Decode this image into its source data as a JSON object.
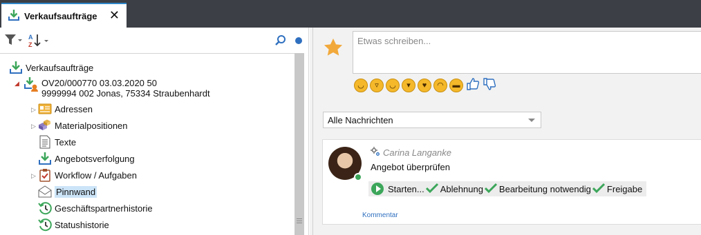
{
  "tab": {
    "title": "Verkaufsaufträge",
    "close_glyph": "✕"
  },
  "toolbar": {
    "filter_icon": "filter-icon",
    "sort_icon": "sort-az-icon",
    "search_icon": "search-icon"
  },
  "tree": {
    "root": {
      "label": "Verkaufsaufträge",
      "icon": "download-arrow-icon"
    },
    "order": {
      "line1": "OV20/000770 03.03.2020 50",
      "line2": "9999994 002 Jonas, 75334 Straubenhardt",
      "icon": "order-person-icon"
    },
    "children": [
      {
        "label": "Adressen",
        "icon": "address-card-icon",
        "expandable": true
      },
      {
        "label": "Materialpositionen",
        "icon": "boxes-icon",
        "expandable": true
      },
      {
        "label": "Texte",
        "icon": "document-icon",
        "expandable": false
      },
      {
        "label": "Angebotsverfolgung",
        "icon": "download-arrow-icon",
        "expandable": false
      },
      {
        "label": "Workflow / Aufgaben",
        "icon": "clipboard-check-icon",
        "expandable": true
      },
      {
        "label": "Pinnwand",
        "icon": "envelope-icon",
        "expandable": false,
        "selected": true
      },
      {
        "label": "Geschäftspartnerhistorie",
        "icon": "history-icon",
        "expandable": false
      },
      {
        "label": "Statushistorie",
        "icon": "history-icon",
        "expandable": false
      }
    ]
  },
  "pinboard": {
    "compose_placeholder": "Etwas schreiben...",
    "filter_selected": "Alle Nachrichten",
    "post": {
      "author": "Carina Langanke",
      "message": "Angebot überprüfen",
      "workflow": [
        "Starten...",
        "Ablehnung",
        "Bearbeitung notwendig",
        "Freigabe"
      ],
      "comment_label": "Kommentar"
    }
  },
  "colors": {
    "accent": "#2e86c9",
    "green": "#3ca65a",
    "topbar": "#3c3f45",
    "selected_bg": "#cce4f7"
  }
}
